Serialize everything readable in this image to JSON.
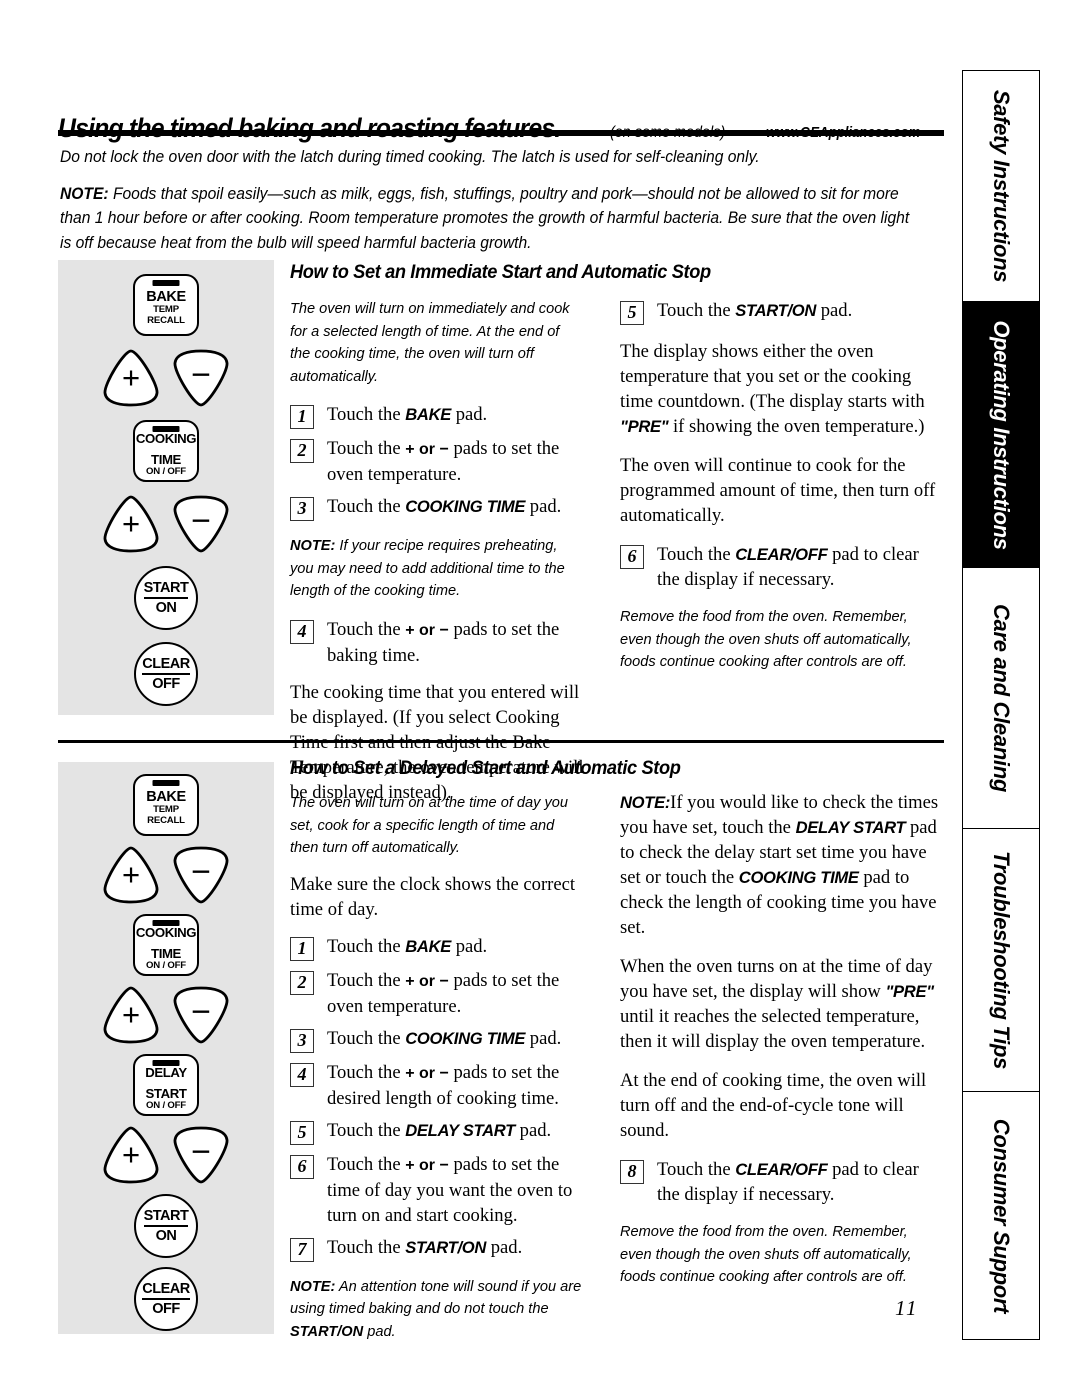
{
  "header": {
    "title": "Using the timed baking and roasting features.",
    "qualifier": "(on some models)",
    "url": "www.GEAppliances.com"
  },
  "intro": {
    "latch_warning": "Do not lock the oven door with the latch during timed cooking. The latch is used for self-cleaning only.",
    "note_label": "NOTE:",
    "note_text": "Foods that spoil easily—such as milk, eggs, fish, stuffings, poultry and pork—should not be allowed to sit for more than 1 hour before or after cooking. Room temperature promotes the growth of harmful bacteria. Be sure that the oven light is off because heat from the bulb will speed harmful bacteria growth."
  },
  "pads": {
    "bake": {
      "line1": "BAKE",
      "line2": "TEMP",
      "line3": "RECALL"
    },
    "cooking_time": {
      "line1": "COOKING",
      "line2": "TIME",
      "line3": "ON / OFF"
    },
    "delay_start": {
      "line1": "DELAY",
      "line2": "START",
      "line3": "ON / OFF"
    },
    "start_on": {
      "line1": "START",
      "line2": "ON"
    },
    "clear_off": {
      "line1": "CLEAR",
      "line2": "OFF"
    },
    "plus": "+",
    "minus": "−"
  },
  "section1": {
    "heading": "How to Set an Immediate Start and Automatic Stop",
    "intro": "The oven will turn on immediately and cook for a selected length of time. At the end of the cooking time, the oven will turn off automatically.",
    "steps": [
      {
        "num": "1",
        "text_before": "Touch the ",
        "bold": "BAKE",
        "text_after": " pad."
      },
      {
        "num": "2",
        "text_before": "Touch the ",
        "bold": "+ or −",
        "text_after": " pads to set the oven temperature."
      },
      {
        "num": "3",
        "text_before": "Touch the ",
        "bold": "COOKING TIME",
        "text_after": " pad."
      },
      {
        "num": "4",
        "text_before": "Touch the ",
        "bold": "+ or −",
        "text_after": " pads to set the baking time."
      },
      {
        "num": "5",
        "text_before": "Touch the ",
        "bold": "START/ON",
        "text_after": " pad."
      },
      {
        "num": "6",
        "text_before": "Touch the ",
        "bold": "CLEAR/OFF",
        "text_after": " pad to clear the display if necessary."
      }
    ],
    "note_preheat_label": "NOTE:",
    "note_preheat": "If your recipe requires preheating, you may need to add additional time to the length of the cooking time.",
    "cooking_time_para": "The cooking time that you entered will be displayed. (If you select Cooking Time first and then adjust the Bake Temperature, the oven temperature will be displayed instead).",
    "display_para_before": "The display shows either the oven temperature that you set or the cooking time countdown. (The display starts with ",
    "display_para_bold": "\"PRE\"",
    "display_para_after": " if showing the oven temperature.)",
    "continue_para": "The oven will continue to cook for the programmed amount of time, then turn off automatically.",
    "remove_food": "Remove the food from the oven. Remember, even though the oven shuts off automatically, foods continue cooking after controls are off."
  },
  "section2": {
    "heading": "How to Set a Delayed Start and Automatic Stop",
    "intro": "The oven will turn on at the time of day you set, cook for a specific length of time and then turn off automatically.",
    "clock_para": "Make sure the clock shows the correct time of day.",
    "steps": [
      {
        "num": "1",
        "text_before": "Touch the ",
        "bold": "BAKE",
        "text_after": " pad."
      },
      {
        "num": "2",
        "text_before": "Touch the ",
        "bold": "+ or −",
        "text_after": " pads to set the oven temperature."
      },
      {
        "num": "3",
        "text_before": "Touch the ",
        "bold": "COOKING TIME",
        "text_after": " pad."
      },
      {
        "num": "4",
        "text_before": "Touch the ",
        "bold": "+ or −",
        "text_after": " pads to set the desired length of cooking time."
      },
      {
        "num": "5",
        "text_before": "Touch the ",
        "bold": "DELAY START",
        "text_after": " pad."
      },
      {
        "num": "6",
        "text_before": "Touch the ",
        "bold": "+ or −",
        "text_after": " pads to set the time of day you want the oven to turn on and start cooking."
      },
      {
        "num": "7",
        "text_before": "Touch the ",
        "bold": "START/ON",
        "text_after": " pad."
      },
      {
        "num": "8",
        "text_before": "Touch the ",
        "bold": "CLEAR/OFF",
        "text_after": " pad to clear the display if necessary."
      }
    ],
    "note_tone_label": "NOTE:",
    "note_tone_1": "An attention tone will sound if you are using timed baking and do not touch the ",
    "note_tone_bold": "START/ON",
    "note_tone_2": " pad.",
    "note_check_label": "NOTE:",
    "note_check_1": "If you would like to check the times you have set, touch the ",
    "note_check_b1": "DELAY START",
    "note_check_2": " pad to check the delay start set time you have set or touch the ",
    "note_check_b2": "COOKING TIME",
    "note_check_3": " pad to check the length of cooking time you have set.",
    "pre_para_1": "When the oven turns on at the time of day you have set, the display will show ",
    "pre_para_bold": "\"PRE\"",
    "pre_para_2": " until it reaches the selected temperature, then it will display the oven temperature.",
    "end_para": "At the end of cooking time, the oven will turn off and the end-of-cycle tone will sound.",
    "remove_food": "Remove the food from the oven. Remember, even though the oven shuts off automatically, foods continue cooking after controls are off."
  },
  "side_tabs": [
    {
      "label": "Safety Instructions",
      "active": false
    },
    {
      "label": "Operating Instructions",
      "active": true
    },
    {
      "label": "Care and Cleaning",
      "active": false
    },
    {
      "label": "Troubleshooting Tips",
      "active": false
    },
    {
      "label": "Consumer Support",
      "active": false
    }
  ],
  "page_number": "11"
}
